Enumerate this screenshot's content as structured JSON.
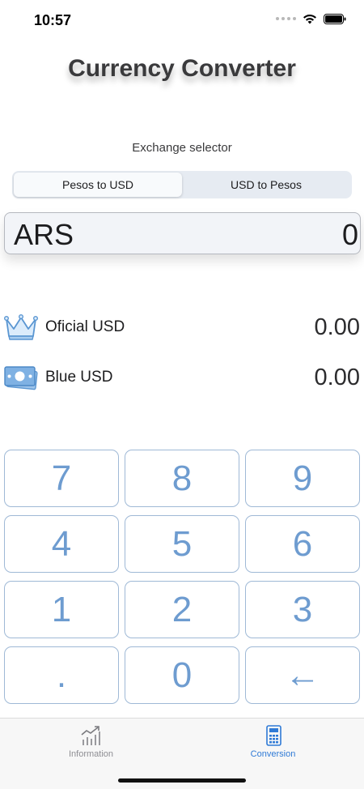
{
  "status_bar": {
    "time": "10:57",
    "icons": [
      "signal-dots-icon",
      "wifi-icon",
      "battery-icon"
    ]
  },
  "title": "Currency Converter",
  "exchange": {
    "label": "Exchange selector",
    "options": [
      "Pesos to USD",
      "USD to Pesos"
    ],
    "selected": "Pesos to USD"
  },
  "amount": {
    "currency": "ARS",
    "value": "0"
  },
  "rates": [
    {
      "icon": "crown-icon",
      "label": "Oficial USD",
      "value": "0.00"
    },
    {
      "icon": "banknote-icon",
      "label": "Blue USD",
      "value": "0.00"
    }
  ],
  "keypad": {
    "rows": [
      [
        "7",
        "8",
        "9"
      ],
      [
        "4",
        "5",
        "6"
      ],
      [
        "1",
        "2",
        "3"
      ],
      [
        ".",
        "0",
        "←"
      ]
    ]
  },
  "tabs": [
    {
      "label": "Information",
      "icon": "chart-icon",
      "active": false
    },
    {
      "label": "Conversion",
      "icon": "calculator-icon",
      "active": true
    }
  ],
  "colors": {
    "accent": "#2f7ad6",
    "key_text": "#6e9cd0",
    "key_border": "#9fb9d6",
    "inactive_tab": "#8e8e93"
  }
}
